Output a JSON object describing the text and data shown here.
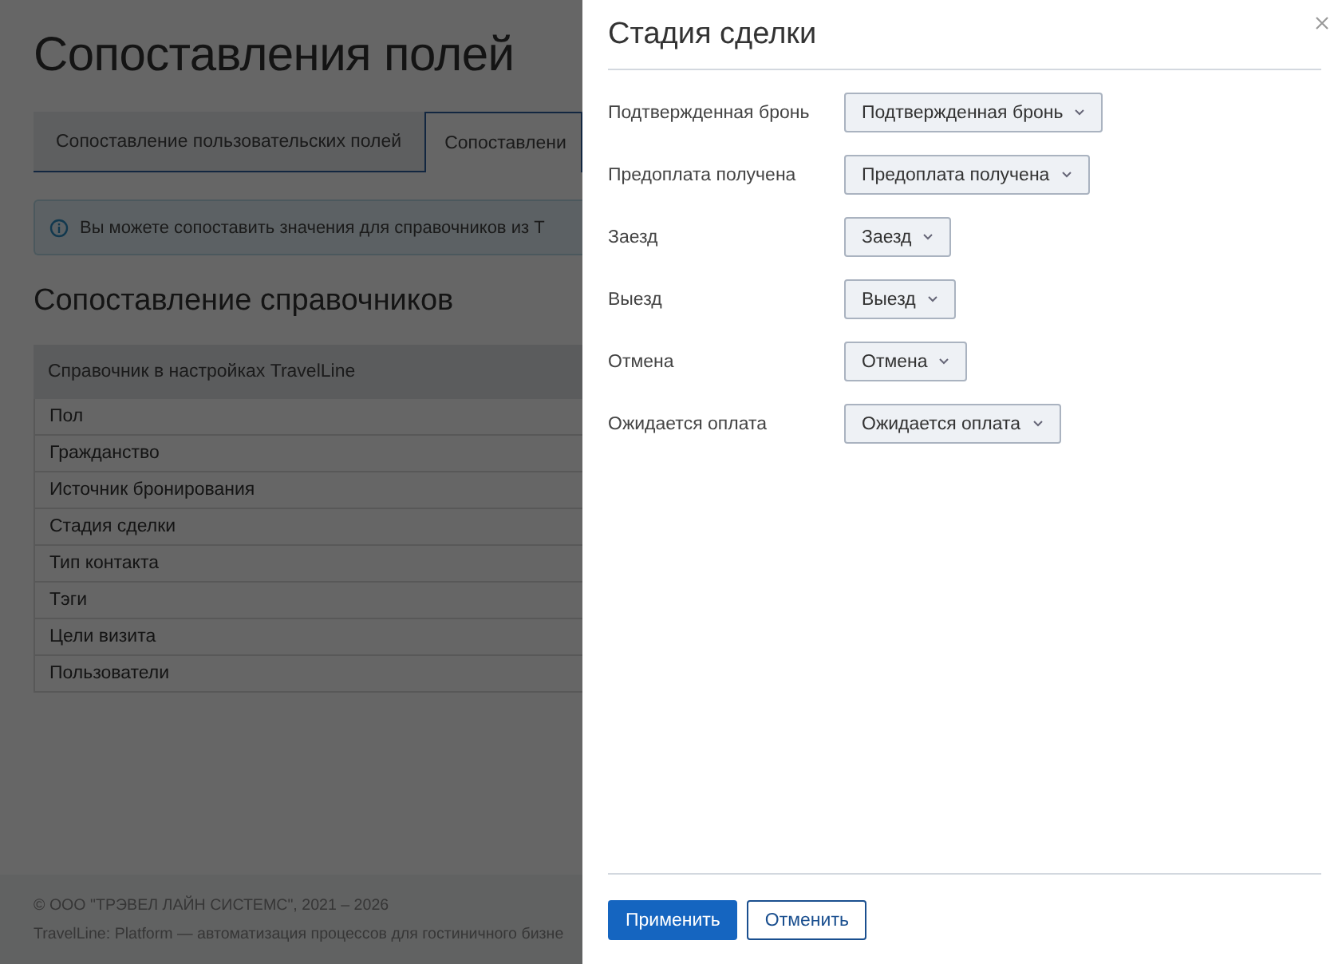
{
  "page": {
    "title": "Сопоставления полей",
    "tabs": [
      {
        "label": "Сопоставление пользовательских полей",
        "selected": false
      },
      {
        "label": "Сопоставлени",
        "selected": true
      }
    ],
    "info": "Вы можете сопоставить значения для справочников из Т",
    "section_title": "Сопоставление справочников",
    "table": {
      "columns": [
        "Справочник в настройках TravelLine"
      ],
      "rows": [
        "Пол",
        "Гражданство",
        "Источник бронирования",
        "Стадия сделки",
        "Тип контакта",
        "Тэги",
        "Цели визита",
        "Пользователи"
      ]
    },
    "footer": [
      "© ООО \"ТРЭВЕЛ ЛАЙН СИСТЕМС\", 2021 – 2026",
      "TravelLine: Platform — автоматизация процессов для гостиничного бизне"
    ]
  },
  "panel": {
    "title": "Стадия сделки",
    "fields": [
      {
        "label": "Подтвержденная бронь",
        "value": "Подтвержденная бронь"
      },
      {
        "label": "Предоплата получена",
        "value": "Предоплата получена"
      },
      {
        "label": "Заезд",
        "value": "Заезд"
      },
      {
        "label": "Выезд",
        "value": "Выезд"
      },
      {
        "label": "Отмена",
        "value": "Отмена"
      },
      {
        "label": "Ожидается оплата",
        "value": "Ожидается оплата"
      }
    ],
    "buttons": [
      {
        "label": "Применить",
        "kind": "primary"
      },
      {
        "label": "Отменить",
        "kind": "secondary"
      }
    ]
  }
}
